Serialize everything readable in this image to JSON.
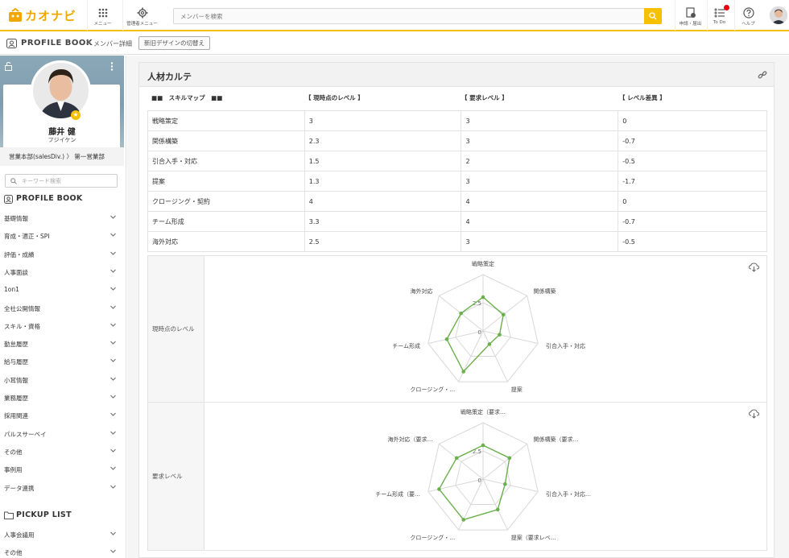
{
  "app": {
    "logo_text": "カオナビ"
  },
  "topbar": {
    "menu_label": "メニュー",
    "admin_label": "管理者メニュー",
    "search_placeholder": "メンバーを検索",
    "apply_label": "申請・届出",
    "todo_label": "To Do",
    "help_label": "ヘルプ",
    "accent": "#f5c000"
  },
  "breadcrumb": {
    "title": "PROFILE BOOK",
    "separator": ">",
    "current": "メンバー詳細",
    "toggle_button": "新旧デザインの切替え"
  },
  "profile": {
    "name": "藤井 健",
    "kana": "フジイケン",
    "dept": "営業本部(salesDiv.) 〉 第一営業部"
  },
  "sidebar": {
    "search_placeholder": "キーワード検索",
    "profile_book_title": "PROFILE BOOK",
    "items": [
      "基礎情報",
      "育成・適正・SPI",
      "評価・成績",
      "人事面談",
      "1on1",
      "全社公開情報",
      "スキル・資格",
      "勤怠履歴",
      "給与履歴",
      "小耳情報",
      "業務履歴",
      "採用関連",
      "パルスサーベイ",
      "その他",
      "事例用",
      "データ連携"
    ],
    "pickup_title": "PICKUP LIST",
    "pickup_items": [
      "人事会議用",
      "その他"
    ]
  },
  "panel": {
    "title": "人材カルテ"
  },
  "skill_table": {
    "headers": [
      "■■　スキルマップ　■■",
      "【 現時点のレベル 】",
      "【 要求レベル 】",
      "【 レベル差異 】"
    ],
    "rows": [
      [
        "戦略策定",
        "3",
        "3",
        "0"
      ],
      [
        "関係構築",
        "2.3",
        "3",
        "-0.7"
      ],
      [
        "引合入手・対応",
        "1.5",
        "2",
        "-0.5"
      ],
      [
        "提案",
        "1.3",
        "3",
        "-1.7"
      ],
      [
        "クロージング・契約",
        "4",
        "4",
        "0"
      ],
      [
        "チーム形成",
        "3.3",
        "4",
        "-0.7"
      ],
      [
        "海外対応",
        "2.5",
        "3",
        "-0.5"
      ]
    ]
  },
  "chart_data": [
    {
      "type": "radar",
      "row_label": "現時点のレベル",
      "axes": [
        "戦略策定",
        "関係構築",
        "引合入手・対応",
        "提案",
        "クロージング・…",
        "チーム形成",
        "海外対応"
      ],
      "values": [
        3,
        2.3,
        1.5,
        1.3,
        4,
        3.3,
        2.5
      ],
      "ticks": [
        "0",
        "2.5"
      ],
      "max": 5,
      "color": "#6ab04c"
    },
    {
      "type": "radar",
      "row_label": "要求レベル",
      "axes": [
        "戦略策定（要求…",
        "関係構築（要求…",
        "引合入手・対応…",
        "提案（要求レベ…",
        "クロージング・…",
        "チーム形成（要…",
        "海外対応（要求…"
      ],
      "values": [
        3,
        3,
        2,
        3,
        4,
        4,
        3
      ],
      "ticks": [
        "0",
        "2.5"
      ],
      "max": 5,
      "color": "#6ab04c"
    }
  ]
}
